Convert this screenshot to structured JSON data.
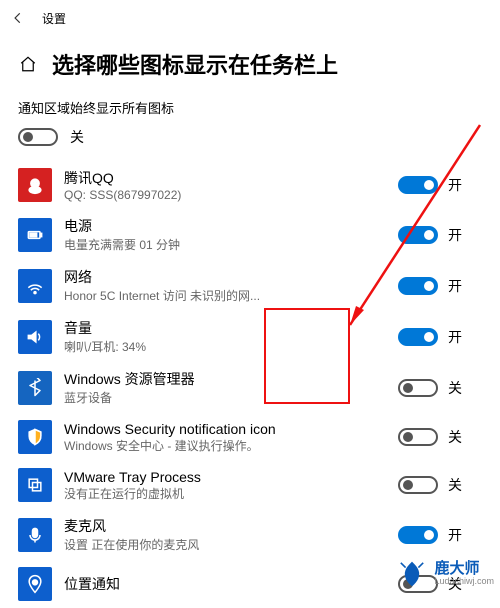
{
  "topbar": {
    "label": "设置"
  },
  "page": {
    "title": "选择哪些图标显示在任务栏上",
    "subheader": "通知区域始终显示所有图标"
  },
  "toggle_text": {
    "on": "开",
    "off": "关"
  },
  "master": {
    "state": "off"
  },
  "items": [
    {
      "name": "腾讯QQ",
      "sub": "QQ: SSS(867997022)",
      "state": "on",
      "icon": "qq"
    },
    {
      "name": "电源",
      "sub": "电量充满需要 01 分钟",
      "state": "on",
      "icon": "power"
    },
    {
      "name": "网络",
      "sub": "Honor 5C Internet 访问  未识别的网...",
      "state": "on",
      "icon": "wifi"
    },
    {
      "name": "音量",
      "sub": "喇叭/耳机: 34%",
      "state": "on",
      "icon": "volume"
    },
    {
      "name": "Windows 资源管理器",
      "sub": "蓝牙设备",
      "state": "off",
      "icon": "bluetooth"
    },
    {
      "name": "Windows Security notification icon",
      "sub": "Windows 安全中心 - 建议执行操作。",
      "state": "off",
      "icon": "shield"
    },
    {
      "name": "VMware Tray Process",
      "sub": "没有正在运行的虚拟机",
      "state": "off",
      "icon": "vmware"
    },
    {
      "name": "麦克风",
      "sub": "设置 正在使用你的麦克风",
      "state": "on",
      "icon": "mic"
    },
    {
      "name": "位置通知",
      "sub": "",
      "state": "off",
      "icon": "location"
    }
  ],
  "watermark": {
    "cn": "鹿大师",
    "en": "Ludashiwj.com"
  }
}
